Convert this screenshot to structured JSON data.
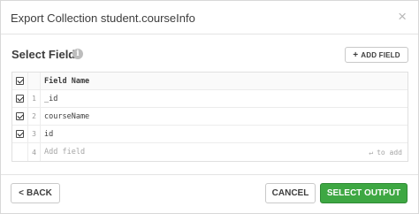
{
  "dialog": {
    "title": "Export Collection student.courseInfo",
    "close_symbol": "×"
  },
  "section": {
    "title": "Select Fields",
    "info_symbol": "i",
    "add_field_label": "ADD FIELD",
    "add_field_icon": "+"
  },
  "table": {
    "header": {
      "label": "Field Name",
      "checked": true
    },
    "rows": [
      {
        "num": "1",
        "field": "_id",
        "checked": true
      },
      {
        "num": "2",
        "field": "courseName",
        "checked": true
      },
      {
        "num": "3",
        "field": "id",
        "checked": true
      }
    ],
    "new_row": {
      "num": "4",
      "placeholder": "Add field",
      "hint": "to add",
      "hint_icon": "↵"
    }
  },
  "footer": {
    "back_label": "BACK",
    "back_icon": "<",
    "cancel_label": "CANCEL",
    "select_output_label": "SELECT OUTPUT"
  },
  "colors": {
    "primary_green": "#3ea743",
    "border": "#c9c9c9"
  }
}
